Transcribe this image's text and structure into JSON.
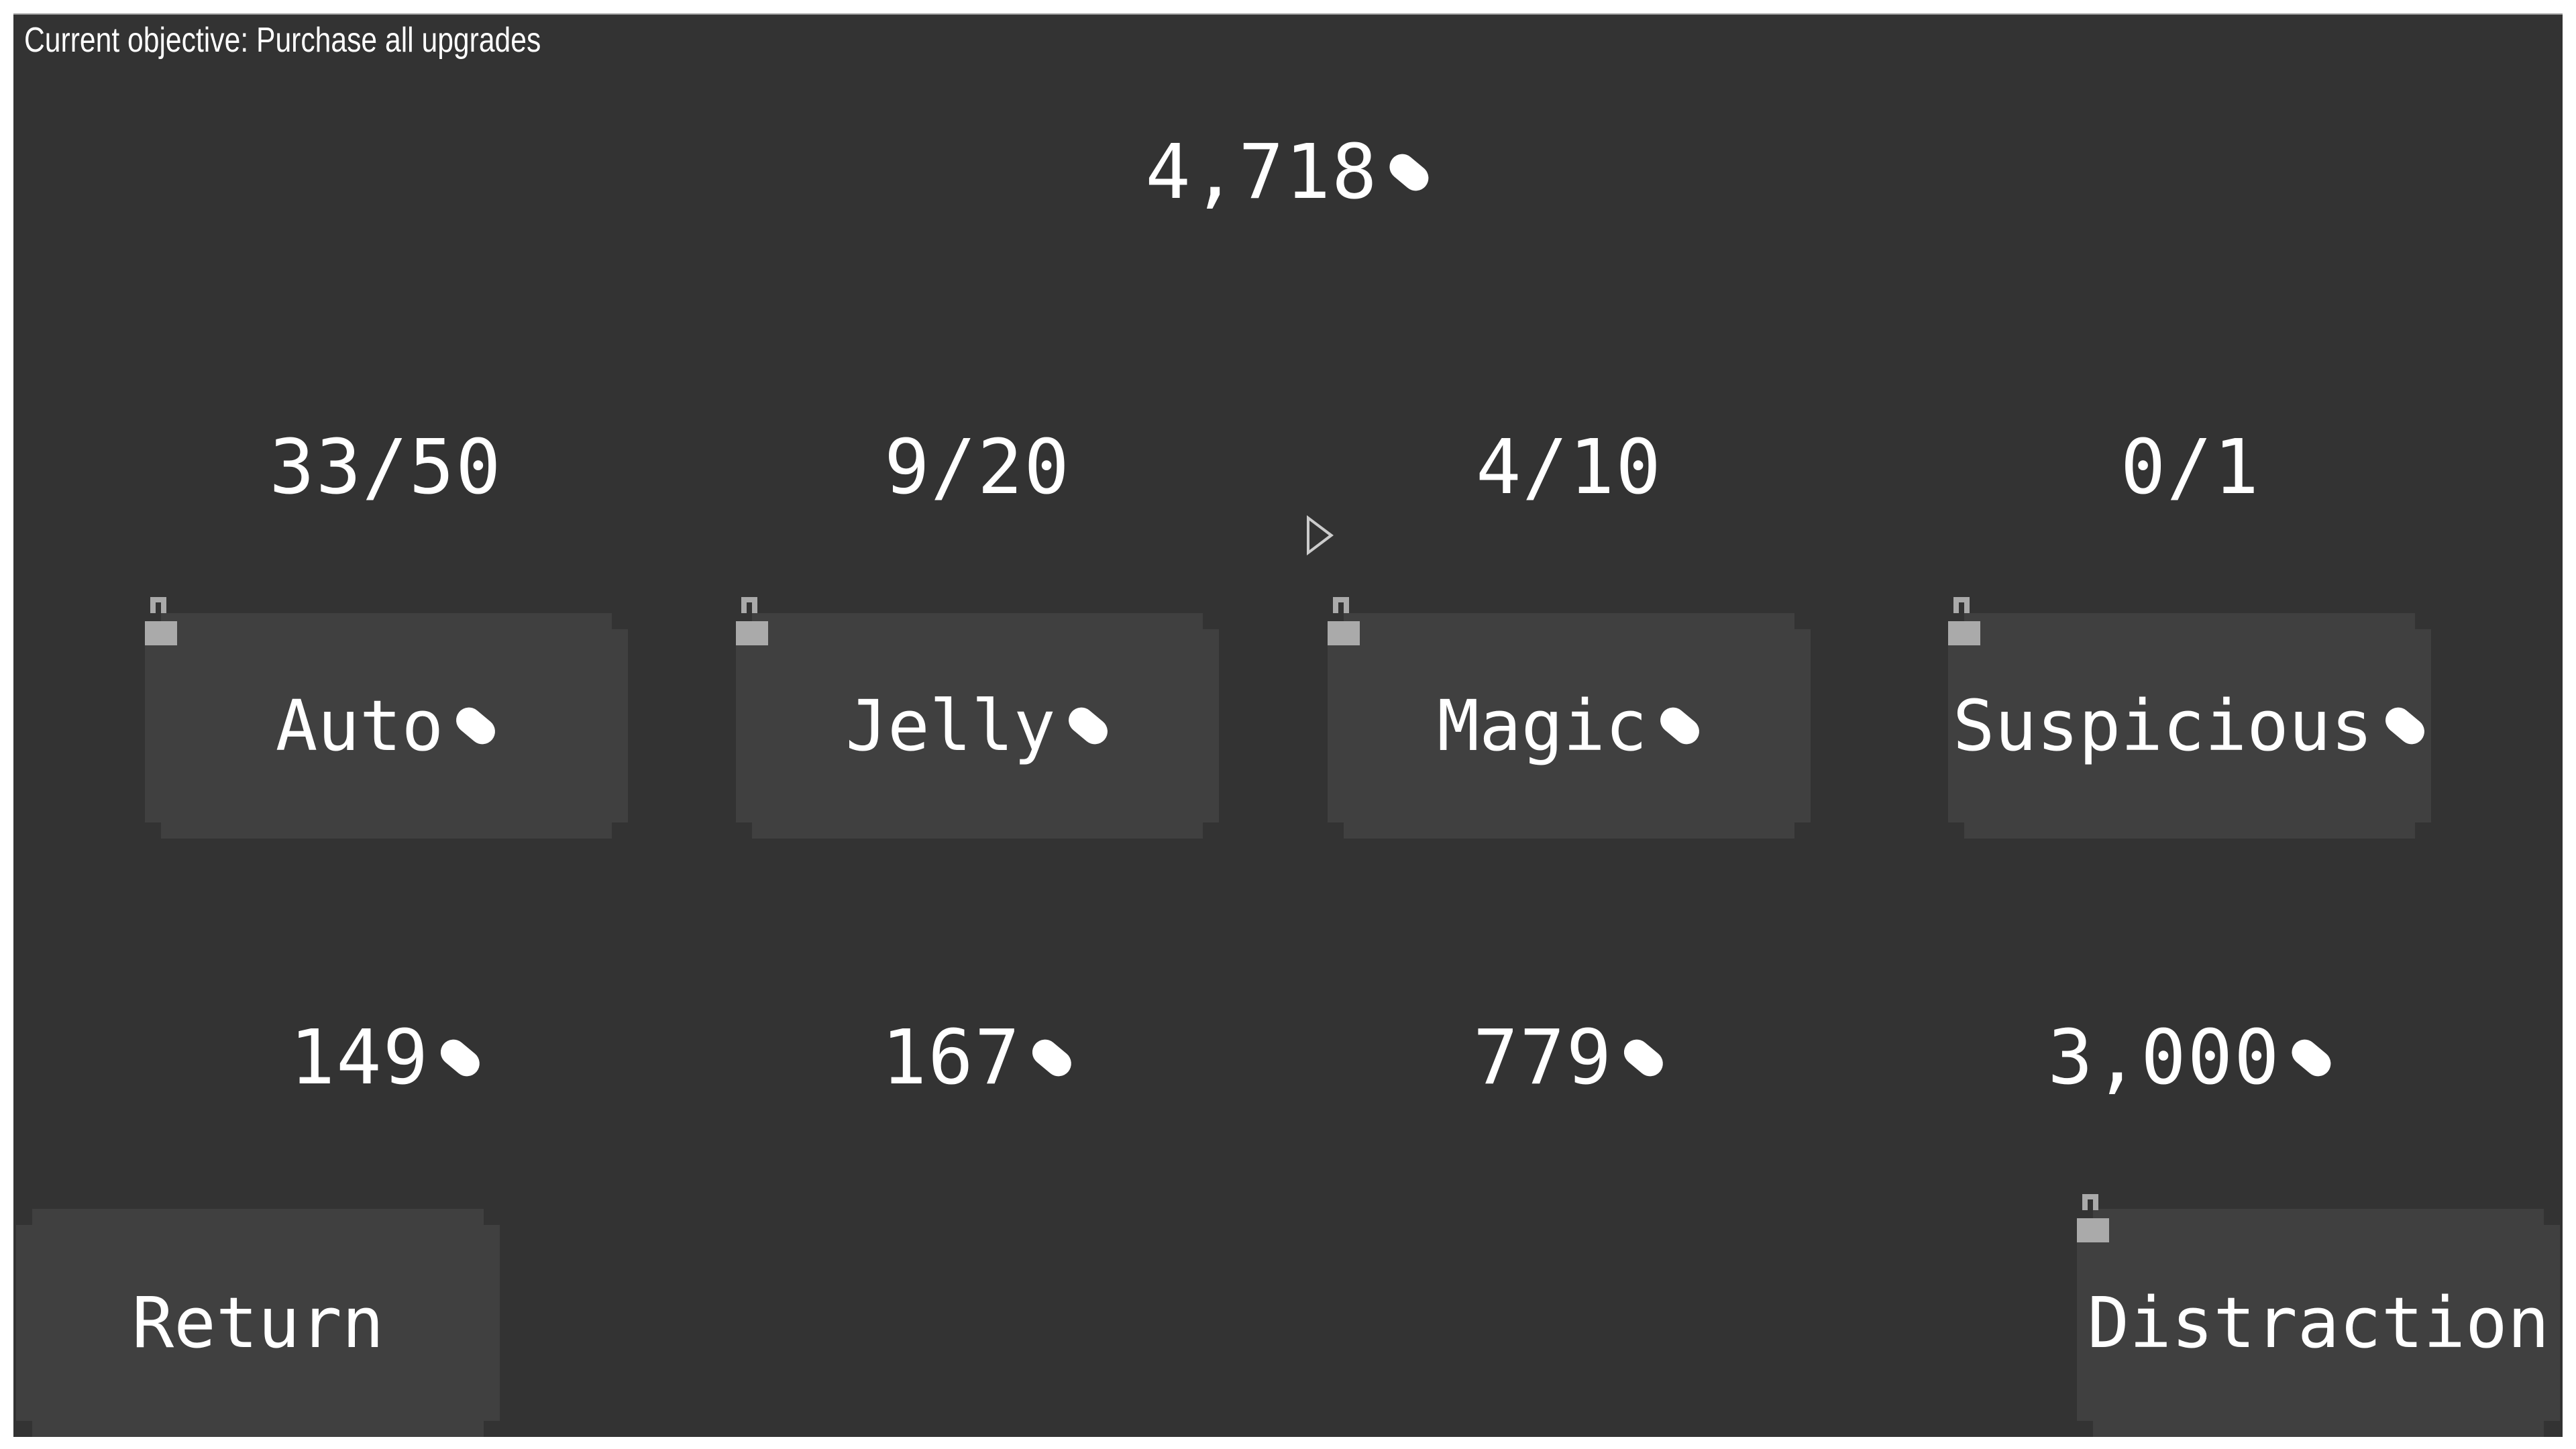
{
  "objective": "Current objective: Purchase all upgrades",
  "currency_total": "4,718",
  "currency_icon": "bean-icon",
  "upgrades": [
    {
      "name": "Auto",
      "count": "33/50",
      "price": "149",
      "locked": true
    },
    {
      "name": "Jelly",
      "count": "9/20",
      "price": "167",
      "locked": true
    },
    {
      "name": "Magic",
      "count": "4/10",
      "price": "779",
      "locked": true
    },
    {
      "name": "Suspicious",
      "count": "0/1",
      "price": "3,000",
      "locked": true
    }
  ],
  "buttons": {
    "return": "Return",
    "distraction": "Distraction"
  },
  "colors": {
    "background": "#333333",
    "button": "#404040",
    "lock": "#aaaaaa",
    "text": "#ffffff"
  }
}
